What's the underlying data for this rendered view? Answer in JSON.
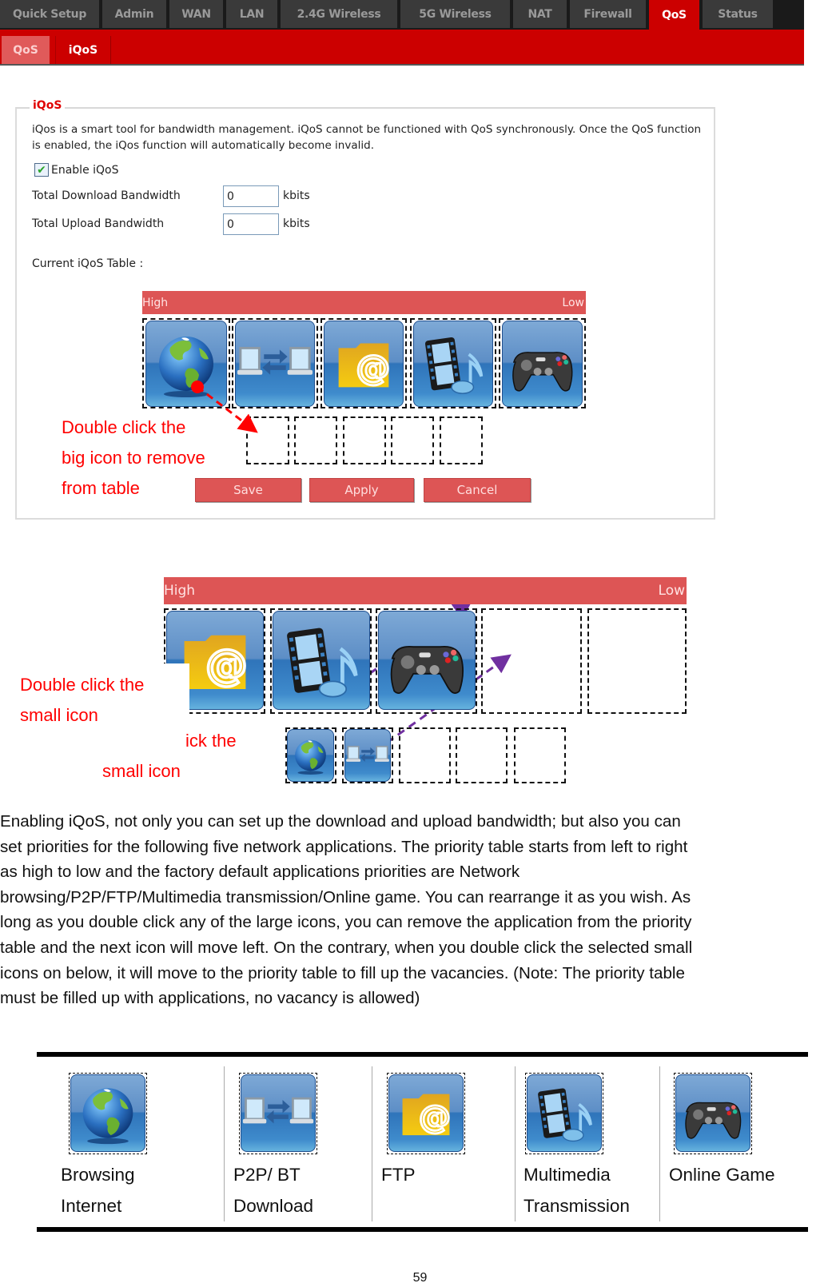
{
  "top_nav": {
    "tabs": [
      {
        "label": "Quick Setup",
        "active": false
      },
      {
        "label": "Admin",
        "active": false
      },
      {
        "label": "WAN",
        "active": false
      },
      {
        "label": "LAN",
        "active": false
      },
      {
        "label": "2.4G Wireless",
        "active": false
      },
      {
        "label": "5G Wireless",
        "active": false
      },
      {
        "label": "NAT",
        "active": false
      },
      {
        "label": "Firewall",
        "active": false
      },
      {
        "label": "QoS",
        "active": true
      },
      {
        "label": "Status",
        "active": false
      }
    ]
  },
  "sub_nav": {
    "tabs": [
      {
        "label": "QoS",
        "active": false
      },
      {
        "label": "iQoS",
        "active": true
      }
    ]
  },
  "iqos_panel": {
    "legend": "iQoS",
    "description": "iQos is a smart tool for bandwidth management. iQoS cannot be functioned with QoS synchronously. Once the QoS function is enabled, the iQos function will automatically become invalid.",
    "enable_label": "Enable iQoS",
    "enable_checked": true,
    "download_label": "Total Download Bandwidth",
    "download_value": "0",
    "upload_label": "Total Upload Bandwidth",
    "upload_value": "0",
    "unit": "kbits",
    "table_label": "Current iQoS Table :",
    "priority_high": "High",
    "priority_low": "Low",
    "priority_order": [
      "Browsing Internet",
      "P2P/ BT Download",
      "FTP",
      "Multimedia Transmission",
      "Online Game"
    ],
    "buttons": {
      "save": "Save",
      "apply": "Apply",
      "cancel": "Cancel"
    },
    "annotation": [
      "Double click the",
      "big icon to remove",
      "from table"
    ]
  },
  "figure2": {
    "priority_high": "High",
    "priority_low": "Low",
    "priority_order": [
      "FTP",
      "Multimedia Transmission",
      "Online Game"
    ],
    "empty_slots": 2,
    "removed_icons": [
      "Browsing Internet",
      "P2P/ BT Download"
    ],
    "annotation": [
      "Double click the",
      "small icon"
    ],
    "annotation_shadow": [
      "ick the",
      "small icon"
    ]
  },
  "body_text": {
    "lines": [
      "Enabling iQoS, not only you can set up the download and upload bandwidth; but also you can",
      "set priorities for the following five network applications. The priority table starts from left to right",
      "as high to low and the factory default applications priorities are Network",
      "browsing/P2P/FTP/Multimedia transmission/Online game. You can rearrange it as you wish. As",
      "long as you double click any of the large icons, you can remove the application from the priority",
      "table and the next icon will move left. On the contrary, when you double click the selected small",
      "icons on below, it will move to the priority table to fill up the vacancies. (Note: The priority table",
      "must be filled up with applications, no vacancy is allowed)"
    ]
  },
  "legend_table": {
    "items": [
      {
        "icon": "globe-icon",
        "line1": "Browsing",
        "line2": "Internet"
      },
      {
        "icon": "p2p-icon",
        "line1": "P2P/ BT",
        "line2": "Download"
      },
      {
        "icon": "ftp-folder-icon",
        "line1": "FTP",
        "line2": ""
      },
      {
        "icon": "multimedia-icon",
        "line1": "Multimedia",
        "line2": "Transmission"
      },
      {
        "icon": "gamepad-icon",
        "line1": "Online Game",
        "line2": ""
      }
    ]
  },
  "page_number": "59",
  "colors": {
    "nav_red": "#cc0000",
    "priority_bar": "#dd5555",
    "annotation_red": "#ff0000",
    "arrow_purple": "#7030a0"
  }
}
